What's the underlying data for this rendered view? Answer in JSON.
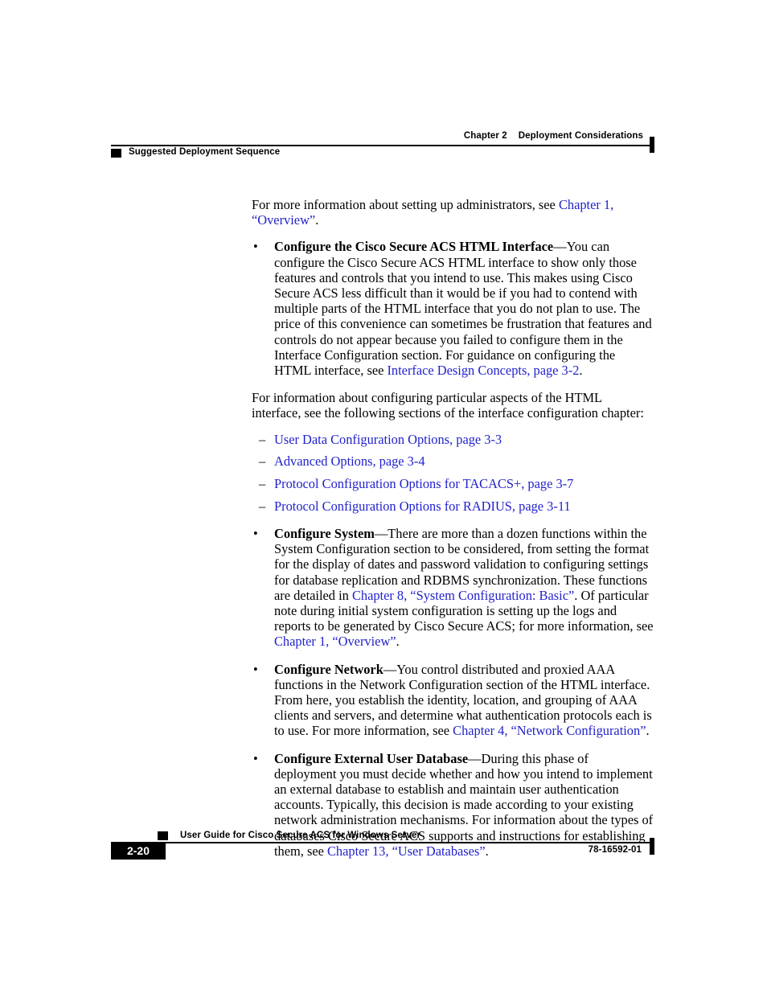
{
  "header": {
    "chapter_label": "Chapter 2",
    "chapter_title": "Deployment Considerations",
    "section_title": "Suggested Deployment Sequence"
  },
  "colors": {
    "link": "#2222cc",
    "text": "#000000",
    "rule": "#000000",
    "page_background": "#ffffff"
  },
  "body": {
    "intro_paragraph": {
      "text_1": "For more information about setting up administrators, see ",
      "link_1": "Chapter 1, “Overview”",
      "text_2": "."
    },
    "bullets": [
      {
        "marker": "•",
        "term": "Configure the Cisco Secure ACS HTML Interface",
        "text_1": "—You can configure the Cisco Secure ACS HTML interface to show only those features and controls that you intend to use. This makes using Cisco Secure ACS less difficult than it would be if you had to contend with multiple parts of the HTML interface that you do not plan to use. The price of this convenience can sometimes be frustration that features and controls do not appear because you failed to configure them in the Interface Configuration section. For guidance on configuring the HTML interface, see ",
        "link_1": "Interface Design Concepts, page 3-2",
        "text_2": "."
      },
      {
        "marker": "•",
        "term": "Configure System",
        "text_1": "—There are more than a dozen functions within the System Configuration section to be considered, from setting the format for the display of dates and password validation to configuring settings for database replication and RDBMS synchronization. These functions are detailed in ",
        "link_1": "Chapter 8, “System Configuration: Basic”",
        "text_2": ". Of particular note during initial system configuration is setting up the logs and reports to be generated by Cisco Secure ACS; for more information, see ",
        "link_2": "Chapter 1, “Overview”",
        "text_3": "."
      },
      {
        "marker": "•",
        "term": "Configure Network",
        "text_1": "—You control distributed and proxied AAA functions in the Network Configuration section of the HTML interface. From here, you establish the identity, location, and grouping of AAA clients and servers, and determine what authentication protocols each is to use. For more information, see ",
        "link_1": "Chapter 4, “Network Configuration”",
        "text_2": "."
      },
      {
        "marker": "•",
        "term": "Configure External User Database",
        "text_1": "—During this phase of deployment you must decide whether and how you intend to implement an external database to establish and maintain user authentication accounts. Typically, this decision is made according to your existing network administration mechanisms. For information about the types of databases Cisco Secure ACS supports and instructions for establishing them, see ",
        "link_1": "Chapter 13, “User Databases”",
        "text_2": "."
      }
    ],
    "sublist_intro": "For information about configuring particular aspects of the HTML interface, see the following sections of the interface configuration chapter:",
    "sublist": [
      {
        "marker": "–",
        "link": "User Data Configuration Options, page 3-3"
      },
      {
        "marker": "–",
        "link": "Advanced Options, page 3-4"
      },
      {
        "marker": "–",
        "link": "Protocol Configuration Options for TACACS+, page 3-7"
      },
      {
        "marker": "–",
        "link": "Protocol Configuration Options for RADIUS, page 3-11"
      }
    ]
  },
  "footer": {
    "guide_title": "User Guide for Cisco Secure ACS for Windows Server",
    "page_number": "2-20",
    "document_number": "78-16592-01"
  }
}
